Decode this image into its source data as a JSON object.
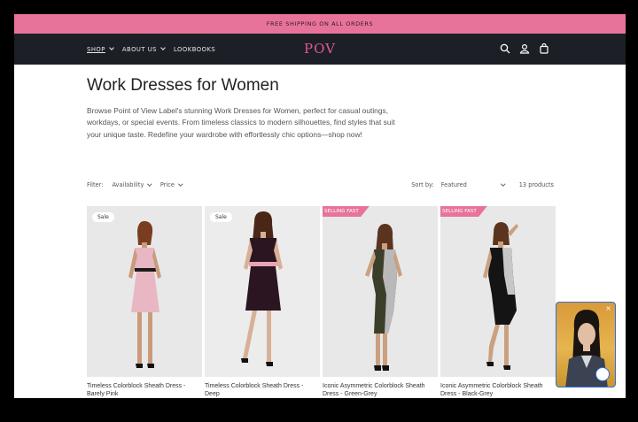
{
  "announcement": "FREE SHIPPING ON ALL ORDERS",
  "header": {
    "nav": [
      {
        "label": "SHOP",
        "has_dropdown": true,
        "active": true
      },
      {
        "label": "ABOUT US",
        "has_dropdown": true
      },
      {
        "label": "LOOKBOOKS",
        "has_dropdown": false
      }
    ],
    "logo": "POV",
    "icons": [
      "search-icon",
      "account-icon",
      "cart-icon"
    ]
  },
  "collection": {
    "title": "Work Dresses for Women",
    "description": "Browse Point of View Label's stunning Work Dresses for Women, perfect for casual outings, workdays, or special events. From timeless classics to modern silhouettes, find styles that suit your unique taste. Redefine your wardrobe with effortlessly chic options—shop now!"
  },
  "filters": {
    "label": "Filter:",
    "availability": "Availability",
    "price": "Price",
    "sort_label": "Sort by:",
    "sort_value": "Featured",
    "count": "13 products"
  },
  "products": [
    {
      "badge": "Sale",
      "badge_type": "sale",
      "title": "Timeless Colorblock Sheath Dress - Barely Pink",
      "dress_color": "#e8b7c3",
      "trim_color": "#1a1a1a"
    },
    {
      "badge": "Sale",
      "badge_type": "sale",
      "title": "Timeless Colorblock Sheath Dress - Deep",
      "dress_color": "#2a1520",
      "trim_color": "#e8a4b8"
    },
    {
      "badge": "SELLING FAST",
      "badge_type": "fast",
      "title": "Iconic Asymmetric Colorblock Sheath Dress - Green-Grey",
      "dress_color": "#3b3f2a",
      "trim_color": "#b9b9b9"
    },
    {
      "badge": "SELLING FAST",
      "badge_type": "fast",
      "title": "Iconic Asymmetric Colorblock Sheath Dress - Black-Grey",
      "dress_color": "#141414",
      "trim_color": "#c7c7c7"
    }
  ],
  "colors": {
    "accent": "#e8739a",
    "header_bg": "#1c1f26",
    "logo": "#e05a8f"
  }
}
